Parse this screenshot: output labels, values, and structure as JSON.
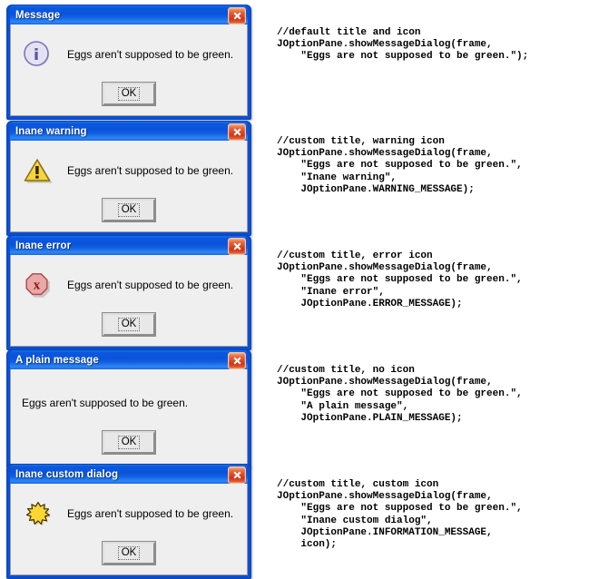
{
  "page": {
    "background": "#ffffff",
    "titlebar_color": "#0b53da",
    "close_button_color": "#cf3414",
    "dialog_body_color": "#efefef"
  },
  "dialogs": [
    {
      "title": "Message",
      "message": "Eggs aren't supposed to be green.",
      "icon": "information-icon",
      "button_label": "OK",
      "close_label": "x"
    },
    {
      "title": "Inane warning",
      "message": "Eggs aren't supposed to be green.",
      "icon": "warning-icon",
      "button_label": "OK",
      "close_label": "x"
    },
    {
      "title": "Inane error",
      "message": "Eggs aren't supposed to be green.",
      "icon": "error-icon",
      "button_label": "OK",
      "close_label": "x"
    },
    {
      "title": "A plain message",
      "message": "Eggs aren't supposed to be green.",
      "icon": "none",
      "button_label": "OK",
      "close_label": "x"
    },
    {
      "title": "Inane custom dialog",
      "message": "Eggs aren't supposed to be green.",
      "icon": "custom-star-icon",
      "button_label": "OK",
      "close_label": "x"
    }
  ],
  "code_samples": [
    {
      "text": "//default title and icon\nJOptionPane.showMessageDialog(frame,\n    \"Eggs are not supposed to be green.\");"
    },
    {
      "text": "//custom title, warning icon\nJOptionPane.showMessageDialog(frame,\n    \"Eggs are not supposed to be green.\",\n    \"Inane warning\",\n    JOptionPane.WARNING_MESSAGE);"
    },
    {
      "text": "//custom title, error icon\nJOptionPane.showMessageDialog(frame,\n    \"Eggs are not supposed to be green.\",\n    \"Inane error\",\n    JOptionPane.ERROR_MESSAGE);"
    },
    {
      "text": "//custom title, no icon\nJOptionPane.showMessageDialog(frame,\n    \"Eggs are not supposed to be green.\",\n    \"A plain message\",\n    JOptionPane.PLAIN_MESSAGE);"
    },
    {
      "text": "//custom title, custom icon\nJOptionPane.showMessageDialog(frame,\n    \"Eggs are not supposed to be green.\",\n    \"Inane custom dialog\",\n    JOptionPane.INFORMATION_MESSAGE,\n    icon);"
    }
  ]
}
